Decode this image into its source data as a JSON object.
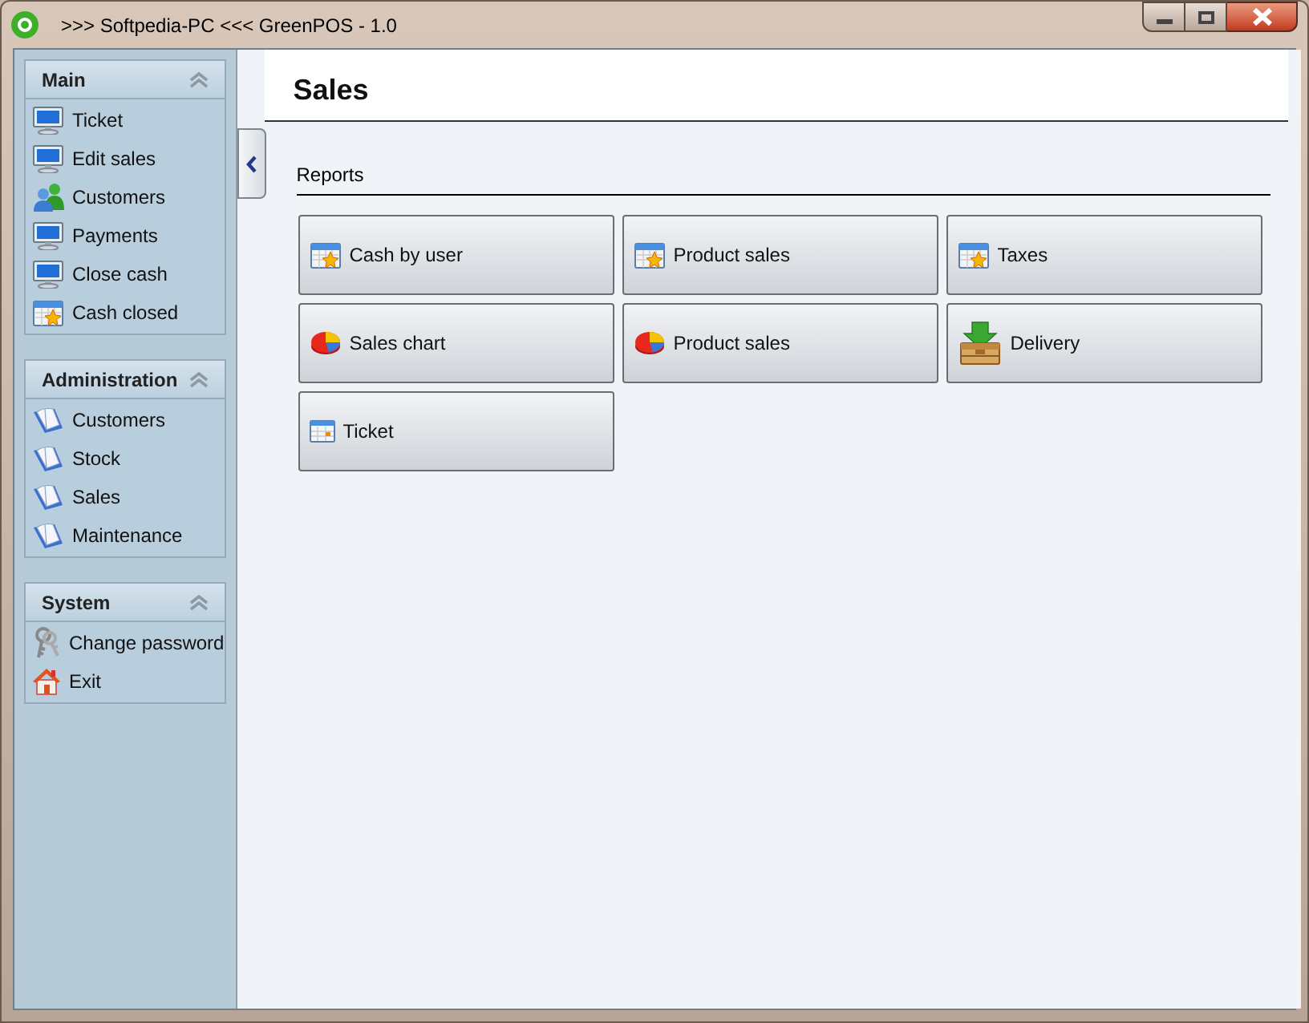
{
  "window": {
    "title": ">>> Softpedia-PC <<< GreenPOS - 1.0"
  },
  "sidebar": {
    "sections": [
      {
        "title": "Main",
        "items": [
          {
            "label": "Ticket",
            "kind": "monitor"
          },
          {
            "label": "Edit sales",
            "kind": "monitor"
          },
          {
            "label": "Customers",
            "kind": "users"
          },
          {
            "label": "Payments",
            "kind": "monitor"
          },
          {
            "label": "Close cash",
            "kind": "monitor"
          },
          {
            "label": "Cash closed",
            "kind": "calendar"
          }
        ]
      },
      {
        "title": "Administration",
        "items": [
          {
            "label": "Customers",
            "kind": "book"
          },
          {
            "label": "Stock",
            "kind": "book"
          },
          {
            "label": "Sales",
            "kind": "book"
          },
          {
            "label": "Maintenance",
            "kind": "book"
          }
        ]
      },
      {
        "title": "System",
        "items": [
          {
            "label": "Change password",
            "kind": "keys"
          },
          {
            "label": "Exit",
            "kind": "house"
          }
        ]
      }
    ]
  },
  "main": {
    "title": "Sales",
    "group": "Reports",
    "buttons": [
      {
        "label": "Cash by user",
        "kind": "calendar"
      },
      {
        "label": "Product sales",
        "kind": "calendar"
      },
      {
        "label": "Taxes",
        "kind": "calendar"
      },
      {
        "label": "Sales chart",
        "kind": "pie"
      },
      {
        "label": "Product sales",
        "kind": "pie"
      },
      {
        "label": "Delivery",
        "kind": "box"
      },
      {
        "label": "Ticket",
        "kind": "calendar-small"
      }
    ]
  }
}
